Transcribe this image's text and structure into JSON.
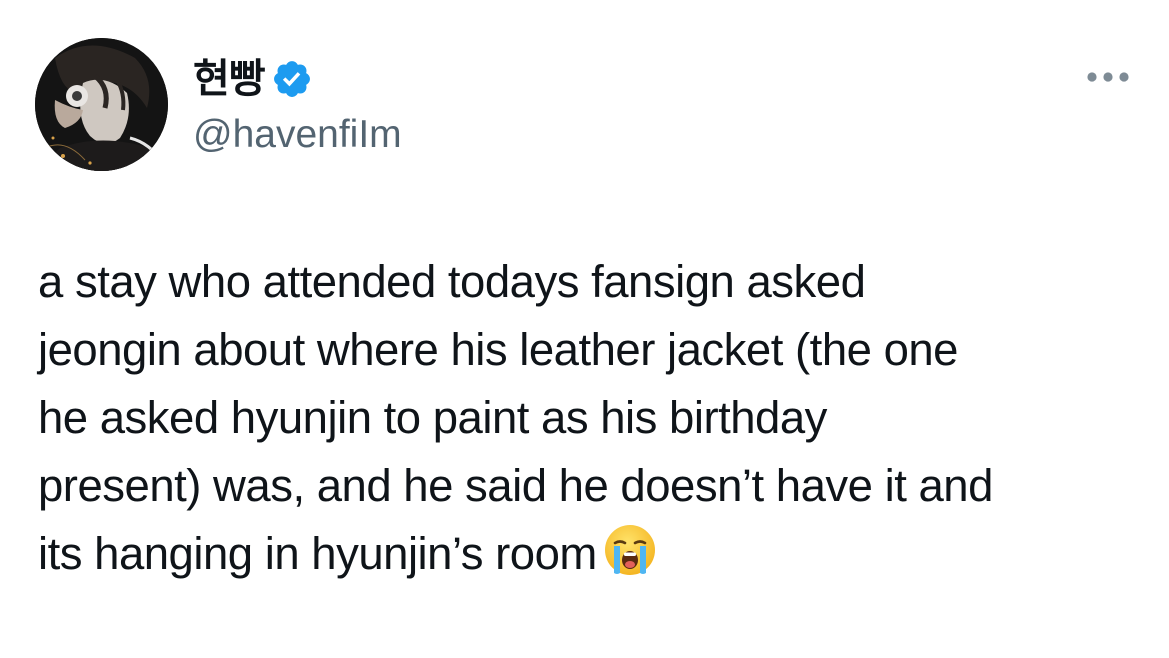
{
  "tweet": {
    "author": {
      "display_name": "현빵",
      "handle": "@havenfiIm",
      "verified": true,
      "verified_badge_color": "#1d9bf0"
    },
    "more_icon": "more-horizontal-icon",
    "text_lines": [
      "a stay who attended todays fansign asked",
      "jeongin about where his leather jacket (the one",
      "he asked hyunjin to paint as his birthday",
      "present) was, and he said he doesn’t have it and",
      "its hanging in hyunjin’s room"
    ],
    "emoji": "loudly-crying-face-emoji"
  }
}
